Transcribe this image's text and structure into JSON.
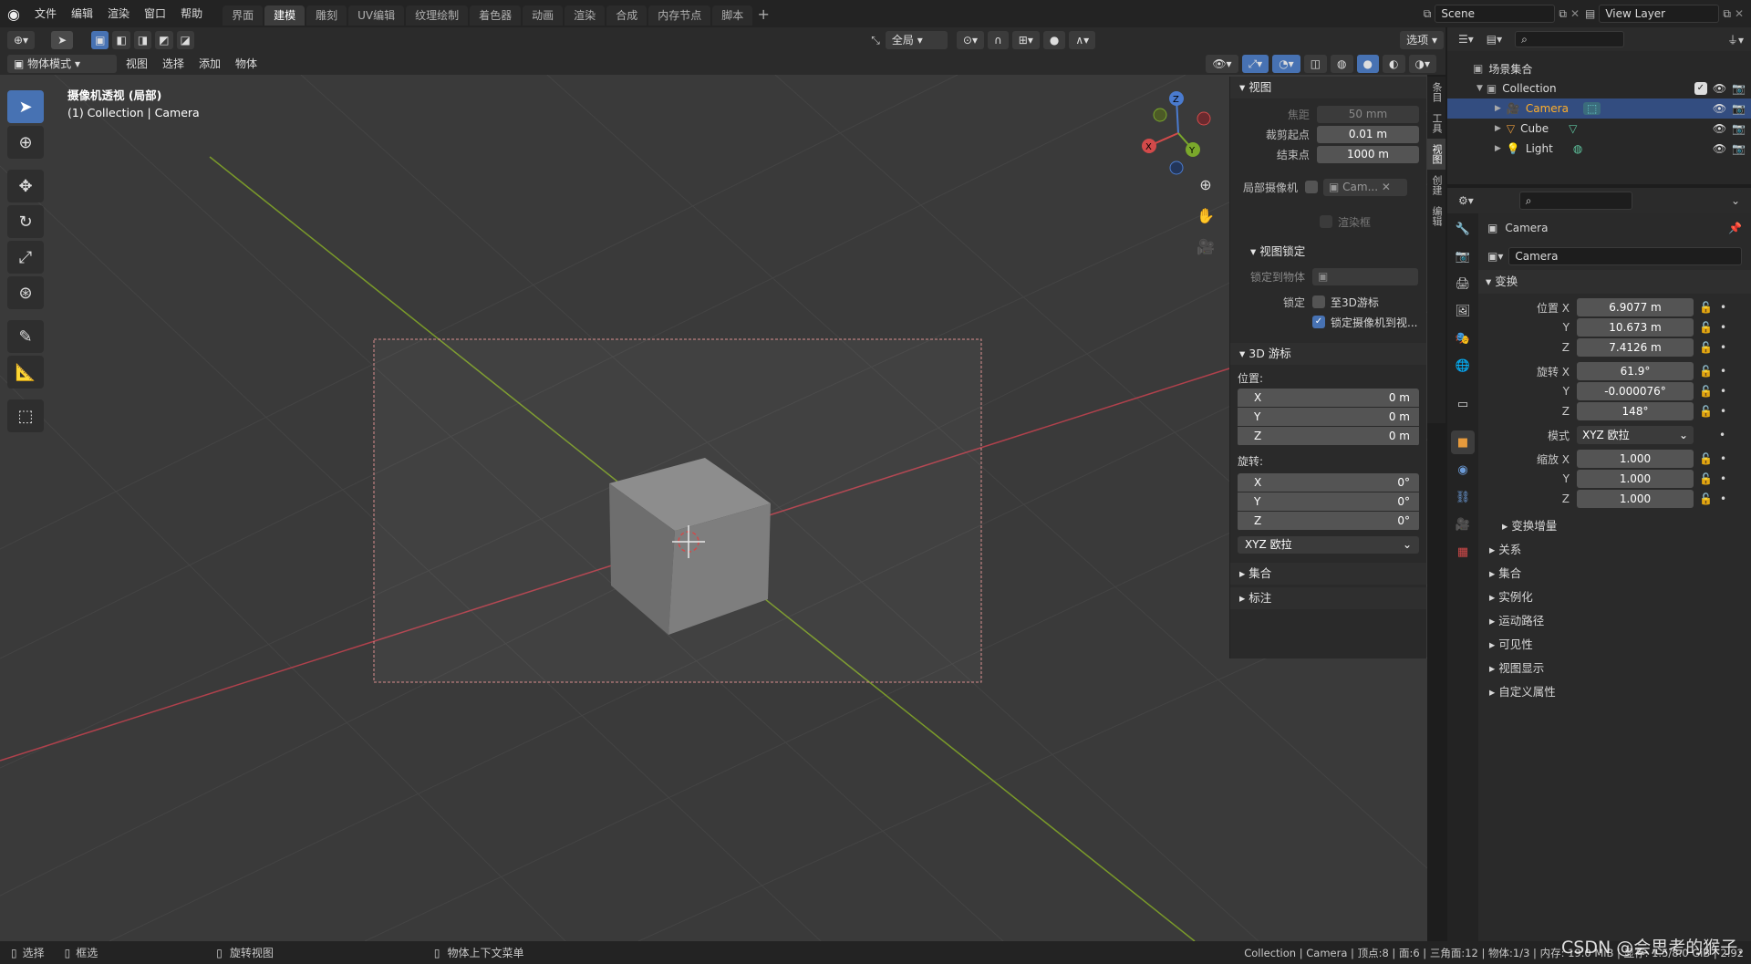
{
  "topbar": {
    "menus": [
      "文件",
      "编辑",
      "渲染",
      "窗口",
      "帮助"
    ],
    "workspaces": [
      "界面",
      "建模",
      "雕刻",
      "UV编辑",
      "纹理绘制",
      "着色器",
      "动画",
      "渲染",
      "合成",
      "内存节点",
      "脚本"
    ],
    "active_workspace": "建模",
    "scene": "Scene",
    "view_layer": "View Layer"
  },
  "toolheader": {
    "transform_orientation": "全局",
    "options": "选项"
  },
  "viewheader": {
    "mode": "物体模式",
    "menus": [
      "视图",
      "选择",
      "添加",
      "物体"
    ]
  },
  "viewport": {
    "title": "摄像机透视 (局部)",
    "subtitle": "(1) Collection | Camera"
  },
  "npanel": {
    "tabs": [
      "条目",
      "工具",
      "视图",
      "创建",
      "编辑"
    ],
    "view_section": "视图",
    "focal_label": "焦距",
    "focal_value": "50 mm",
    "clip_start_label": "裁剪起点",
    "clip_start_value": "0.01 m",
    "clip_end_label": "结束点",
    "clip_end_value": "1000 m",
    "local_camera_label": "局部摄像机",
    "local_camera_value": "Cam...",
    "render_region_label": "渲染框",
    "view_lock_section": "视图锁定",
    "lock_object_label": "锁定到物体",
    "lock_label": "锁定",
    "lock_3d_cursor": "至3D游标",
    "lock_camera_to_view": "锁定摄像机到视...",
    "cursor_section": "3D 游标",
    "location_label": "位置:",
    "location": [
      {
        "axis": "X",
        "value": "0 m"
      },
      {
        "axis": "Y",
        "value": "0 m"
      },
      {
        "axis": "Z",
        "value": "0 m"
      }
    ],
    "rotation_label": "旋转:",
    "rotation": [
      {
        "axis": "X",
        "value": "0°"
      },
      {
        "axis": "Y",
        "value": "0°"
      },
      {
        "axis": "Z",
        "value": "0°"
      }
    ],
    "rotation_mode": "XYZ 欧拉",
    "collection_section": "集合",
    "annotation_section": "标注"
  },
  "outliner": {
    "scene_collection": "场景集合",
    "collection": "Collection",
    "items": [
      {
        "name": "Camera",
        "selected": true,
        "color": "#e69a3c"
      },
      {
        "name": "Cube",
        "selected": false,
        "color": "#e69a3c"
      },
      {
        "name": "Light",
        "selected": false,
        "color": "#e69a3c"
      }
    ]
  },
  "properties": {
    "object_name": "Camera",
    "object_field": "Camera",
    "transform_section": "变换",
    "location_x_label": "位置 X",
    "location": [
      "6.9077 m",
      "10.673 m",
      "7.4126 m"
    ],
    "rotation_x_label": "旋转 X",
    "rotation": [
      "61.9°",
      "-0.000076°",
      "148°"
    ],
    "mode_label": "模式",
    "mode_value": "XYZ 欧拉",
    "scale_x_label": "缩放 X",
    "scale": [
      "1.000",
      "1.000",
      "1.000"
    ],
    "y_label": "Y",
    "z_label": "Z",
    "delta_transform": "变换增量",
    "sections": [
      "关系",
      "集合",
      "实例化",
      "运动路径",
      "可见性",
      "视图显示",
      "自定义属性"
    ]
  },
  "statusbar": {
    "select": "选择",
    "box_select": "框选",
    "rotate_view": "旋转视图",
    "context_menu": "物体上下文菜单",
    "stats": "Collection | Camera | 顶点:8 | 面:6 | 三角面:12 | 物体:1/3 | 内存: 19.0 MiB | 显存: 1.5/8.0 GiB | 2.92",
    "watermark": "CSDN @会思考的猴子."
  }
}
